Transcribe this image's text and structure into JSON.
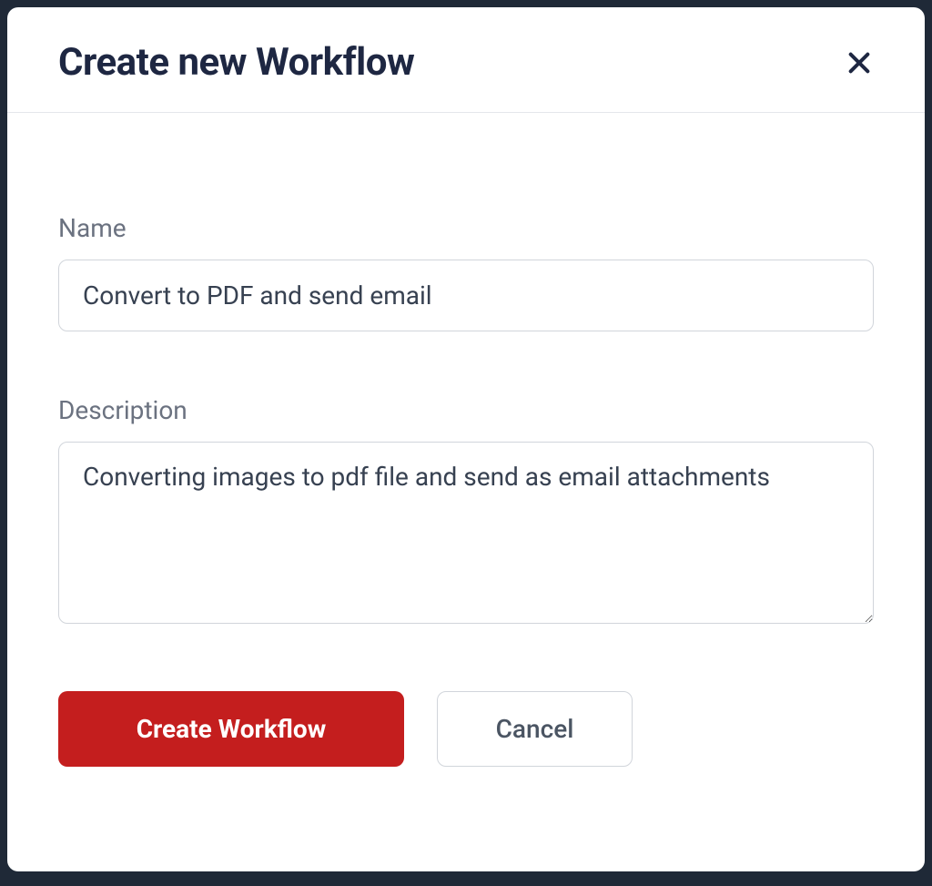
{
  "modal": {
    "title": "Create new Workflow",
    "form": {
      "name_label": "Name",
      "name_value": "Convert to PDF and send email",
      "description_label": "Description",
      "description_value": "Converting images to pdf file and send as email attachments"
    },
    "buttons": {
      "primary": "Create Workflow",
      "secondary": "Cancel"
    }
  }
}
